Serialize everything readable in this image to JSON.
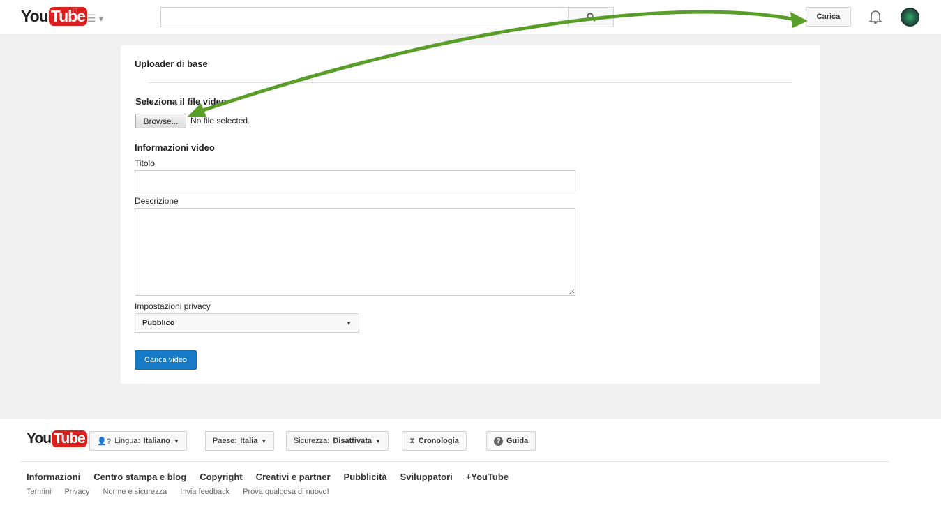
{
  "header": {
    "logo": "YouTube",
    "logo_you": "You",
    "logo_tube": "Tube",
    "region": "IT",
    "upload_label": "Carica",
    "search_placeholder": ""
  },
  "uploader": {
    "title": "Uploader di base",
    "file_heading": "Seleziona il file video",
    "browse_label": "Browse...",
    "no_file": "No file selected.",
    "info_heading": "Informazioni video",
    "title_label": "Titolo",
    "title_value": "",
    "description_label": "Descrizione",
    "description_value": "",
    "privacy_label": "Impostazioni privacy",
    "privacy_value": "Pubblico",
    "submit_label": "Carica video"
  },
  "annotation": {
    "arrow_color": "#5a9e2a"
  },
  "footer": {
    "logo_you": "You",
    "logo_tube": "Tube",
    "language_prefix": "Lingua:",
    "language": "Italiano",
    "country_prefix": "Paese:",
    "country": "Italia",
    "safety_prefix": "Sicurezza:",
    "safety": "Disattivata",
    "history": "Cronologia",
    "help": "Guida",
    "links": [
      "Informazioni",
      "Centro stampa e blog",
      "Copyright",
      "Creativi e partner",
      "Pubblicità",
      "Sviluppatori",
      "+YouTube"
    ],
    "small_links": [
      "Termini",
      "Privacy",
      "Norme e sicurezza",
      "Invia feedback",
      "Prova qualcosa di nuovo!"
    ]
  }
}
